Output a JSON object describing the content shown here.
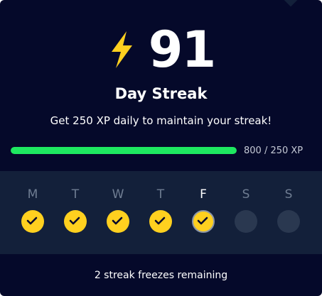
{
  "streak": {
    "icon": "lightning-bolt-icon",
    "count": "91",
    "title": "Day Streak",
    "subtitle": "Get 250 XP daily to maintain your streak!"
  },
  "progress": {
    "current_xp": 800,
    "goal_xp": 250,
    "fraction": 1.0,
    "label": "800 / 250 XP",
    "fill_color": "#1ee860"
  },
  "week": {
    "days": [
      {
        "letter": "M",
        "completed": true,
        "current": false
      },
      {
        "letter": "T",
        "completed": true,
        "current": false
      },
      {
        "letter": "W",
        "completed": true,
        "current": false
      },
      {
        "letter": "T",
        "completed": true,
        "current": false
      },
      {
        "letter": "F",
        "completed": true,
        "current": true
      },
      {
        "letter": "S",
        "completed": false,
        "current": false
      },
      {
        "letter": "S",
        "completed": false,
        "current": false
      }
    ]
  },
  "footer": {
    "freezes_text": "2 streak freezes remaining"
  },
  "colors": {
    "background": "#05092a",
    "panel": "#13203a",
    "accent_yellow": "#ffd01f",
    "progress_green": "#1ee860"
  }
}
